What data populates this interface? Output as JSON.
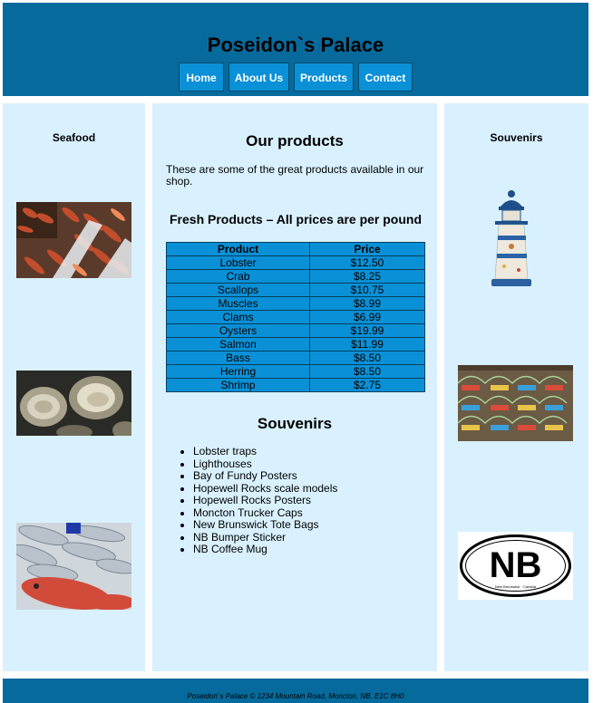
{
  "header": {
    "title": "Poseidon`s Palace",
    "nav": [
      "Home",
      "About Us",
      "Products",
      "Contact"
    ]
  },
  "left": {
    "heading": "Seafood",
    "images": [
      "shrimp-photo",
      "oysters-photo",
      "fish-photo"
    ]
  },
  "main": {
    "heading": "Our products",
    "intro": "These are some of the great products available in our shop.",
    "fresh_heading": "Fresh Products – All prices are per pound",
    "table": {
      "headers": [
        "Product",
        "Price"
      ],
      "rows": [
        [
          "Lobster",
          "$12.50"
        ],
        [
          "Crab",
          "$8.25"
        ],
        [
          "Scallops",
          "$10.75"
        ],
        [
          "Muscles",
          "$8.99"
        ],
        [
          "Clams",
          "$6.99"
        ],
        [
          "Oysters",
          "$19.99"
        ],
        [
          "Salmon",
          "$11.99"
        ],
        [
          "Bass",
          "$8.50"
        ],
        [
          "Herring",
          "$8.50"
        ],
        [
          "Shrimp",
          "$2.75"
        ]
      ]
    },
    "souvenirs_heading": "Souvenirs",
    "souvenirs": [
      "Lobster traps",
      "Lighthouses",
      "Bay of Fundy Posters",
      "Hopewell Rocks scale models",
      "Hopewell Rocks Posters",
      "Moncton Trucker Caps",
      "New Brunswick Tote Bags",
      "NB Bumper Sticker",
      "NB Coffee Mug"
    ]
  },
  "right": {
    "heading": "Souvenirs",
    "sticker_text": "NB",
    "sticker_subtext": "New Brunswick · Canada"
  },
  "footer": {
    "text": "Poseidon`s Palace © 1234 Mountain Road, Moncton, NB. E1C 8H0"
  },
  "colors": {
    "header_bg": "#066a9c",
    "column_bg": "#d9f1fe",
    "button_bg": "#0a90d6"
  }
}
